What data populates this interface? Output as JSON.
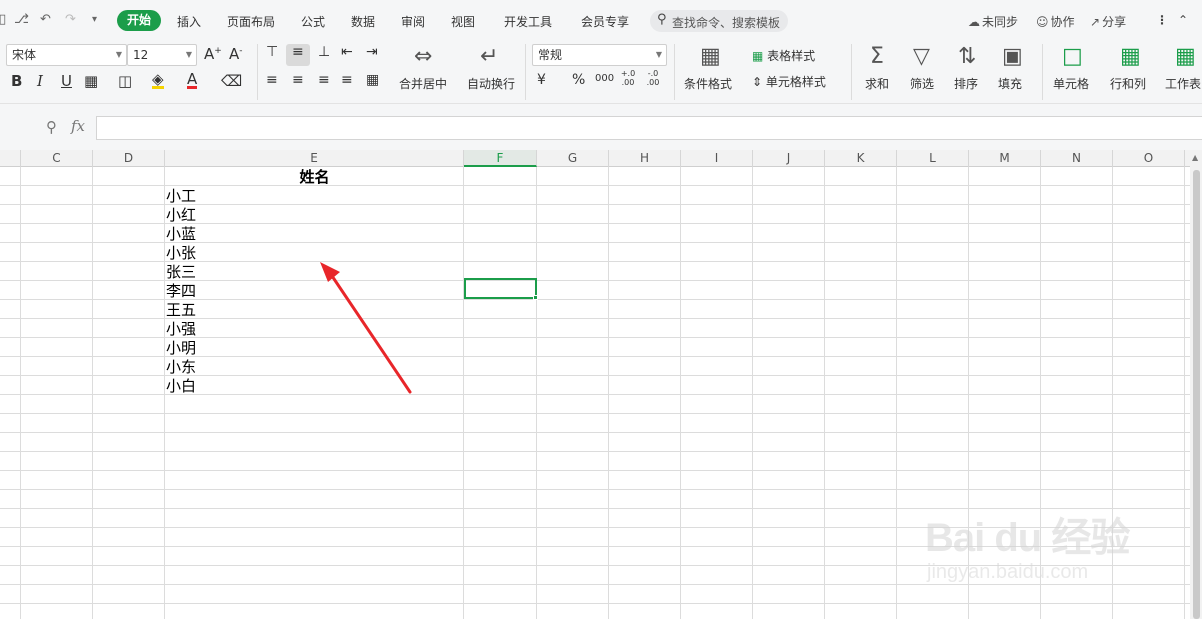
{
  "quick_access": {
    "save_icon": "save-icon",
    "preview_icon": "print-preview-icon",
    "undo_icon": "undo-icon",
    "redo_icon": "redo-icon",
    "more_icon": "chevron-down-icon"
  },
  "menu_tabs": {
    "home": "开始",
    "insert": "插入",
    "layout": "页面布局",
    "formula": "公式",
    "data": "数据",
    "review": "审阅",
    "view": "视图",
    "developer": "开发工具",
    "member": "会员专享"
  },
  "search": {
    "placeholder": "查找命令、搜索模板"
  },
  "right_actions": {
    "sync": "未同步",
    "collab": "协作",
    "share": "分享"
  },
  "ribbon": {
    "font_name": "宋体",
    "font_size": "12",
    "number_format": "常规",
    "merge_center": "合并居中",
    "wrap_text": "自动换行",
    "conditional_format": "条件格式",
    "table_style": "表格样式",
    "cell_style": "单元格样式",
    "sum": "求和",
    "filter": "筛选",
    "sort": "排序",
    "fill": "填充",
    "cell": "单元格",
    "row_col": "行和列",
    "worksheet": "工作表",
    "bold": "B",
    "italic": "I",
    "underline": "U",
    "currency": "¥",
    "percent": "%",
    "thousands": "000",
    "inc_decimal": "+.0 .00",
    "dec_decimal": "-.0 .00"
  },
  "formula_bar": {
    "fx_label": "fx",
    "value": ""
  },
  "columns": [
    "C",
    "D",
    "E",
    "F",
    "G",
    "H",
    "I",
    "J",
    "K",
    "L",
    "M",
    "N",
    "O"
  ],
  "active_column": "F",
  "cells": {
    "header": "姓名",
    "names": [
      "小工",
      "小红",
      "小蓝",
      "小张",
      "张三",
      "李四",
      "王五",
      "小强",
      "小明",
      "小东",
      "小白"
    ]
  },
  "watermark": {
    "logo_text": "Bai du 经验",
    "url": "jingyan.baidu.com"
  },
  "colors": {
    "accent": "#1b9d4a",
    "arrow": "#e8262a"
  }
}
